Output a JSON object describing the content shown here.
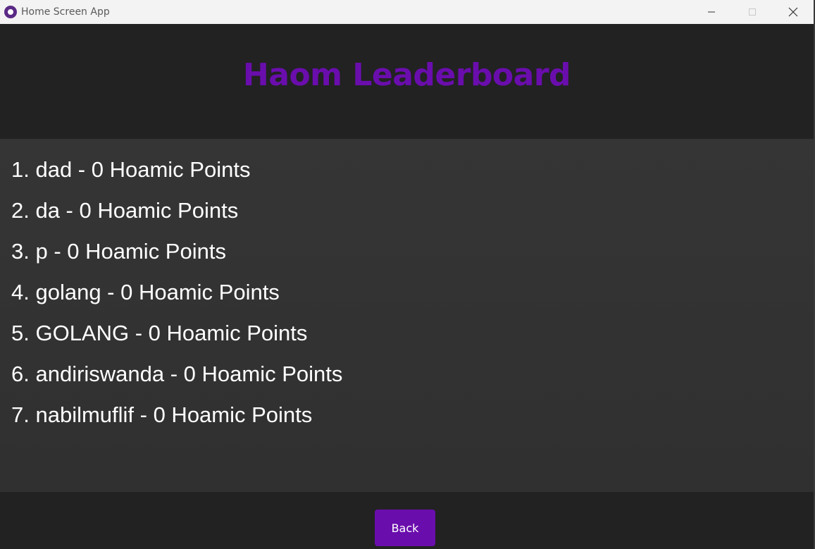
{
  "window": {
    "title": "Home Screen App",
    "controls": {
      "minimize": "minimize",
      "maximize": "maximize",
      "close": "close"
    }
  },
  "header": {
    "title": "Haom Leaderboard",
    "title_color": "#6a0dad"
  },
  "leaderboard": {
    "items": [
      "1. dad - 0 Hoamic Points",
      "2. da - 0 Hoamic Points",
      "3. p - 0 Hoamic Points",
      "4. golang - 0 Hoamic Points",
      "5. GOLANG - 0 Hoamic Points",
      "6. andiriswanda - 0 Hoamic Points",
      "7. nabilmuflif - 0 Hoamic Points"
    ]
  },
  "footer": {
    "back_label": "Back",
    "button_color": "#6a0dad"
  },
  "icons": {
    "app": "app-logo-icon",
    "minimize": "minimize-icon",
    "maximize": "maximize-icon",
    "close": "close-icon"
  }
}
